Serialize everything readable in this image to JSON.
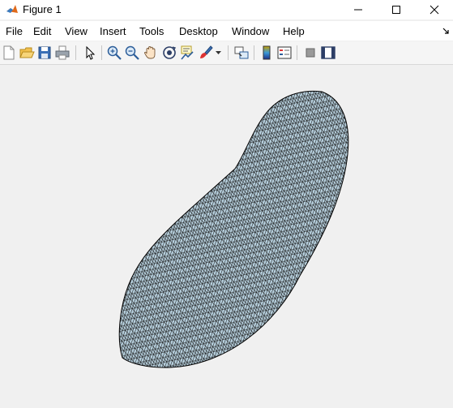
{
  "window": {
    "title": "Figure 1",
    "app_icon": "matlab-logo-icon",
    "controls": [
      "minimize-icon",
      "maximize-icon",
      "close-icon"
    ]
  },
  "menubar": {
    "items": [
      "File",
      "Edit",
      "View",
      "Insert",
      "Tools",
      "Desktop",
      "Window",
      "Help"
    ],
    "dock_icon": "dock-arrow-icon"
  },
  "toolbar": {
    "buttons": [
      "new-figure-icon",
      "open-file-icon",
      "save-icon",
      "print-icon",
      "edit-plot-icon",
      "zoom-in-icon",
      "zoom-out-icon",
      "pan-icon",
      "rotate-3d-icon",
      "data-cursor-icon",
      "brush-icon",
      "link-plot-icon",
      "colorbar-icon",
      "legend-icon",
      "hide-plot-tools-icon",
      "show-plot-tools-icon"
    ]
  },
  "figure": {
    "content": "triangular-mesh-plot",
    "mesh_fill_color": "#b9d2e0",
    "mesh_edge_color": "#1a1a1a",
    "background_color": "#f0f0f0"
  }
}
